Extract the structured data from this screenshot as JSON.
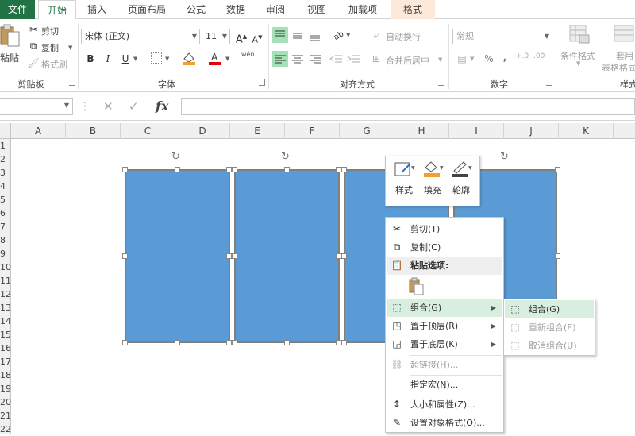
{
  "tabs": [
    {
      "label": "文件"
    },
    {
      "label": "开始"
    },
    {
      "label": "插入"
    },
    {
      "label": "页面布局"
    },
    {
      "label": "公式"
    },
    {
      "label": "数据"
    },
    {
      "label": "审阅"
    },
    {
      "label": "视图"
    },
    {
      "label": "加载项"
    },
    {
      "label": "格式"
    }
  ],
  "clipboard": {
    "paste": "粘贴",
    "cut": "剪切",
    "copy": "复制",
    "format_painter": "格式刷",
    "group": "剪贴板"
  },
  "font": {
    "name": "宋体 (正文)",
    "size": "11",
    "group": "字体",
    "bold": "B",
    "italic": "I",
    "underline": "U",
    "grow": "A",
    "shrink": "A",
    "phonetic": "wén"
  },
  "alignment": {
    "wrap": "自动换行",
    "merge": "合并后居中",
    "group": "对齐方式"
  },
  "number": {
    "format": "常规",
    "group": "数字",
    "percent": "%",
    "comma": ","
  },
  "styles": {
    "conditional": "条件格式",
    "table_line1": "套用",
    "table_line2": "表格格式",
    "group": "样式"
  },
  "formula_bar": {
    "fx": "fx",
    "cancel": "✕",
    "enter": "✓",
    "value": ""
  },
  "columns": [
    "A",
    "B",
    "C",
    "D",
    "E",
    "F",
    "G",
    "H",
    "I",
    "J",
    "K"
  ],
  "rows": [
    "1",
    "2",
    "3",
    "4",
    "5",
    "6",
    "7",
    "8",
    "9",
    "10",
    "11",
    "12",
    "13",
    "14",
    "15",
    "16",
    "17",
    "18",
    "19",
    "20",
    "21",
    "22"
  ],
  "mini_toolbar": [
    {
      "label": "样式"
    },
    {
      "label": "填充"
    },
    {
      "label": "轮廓"
    }
  ],
  "context_menu": {
    "cut": "剪切(T)",
    "copy": "复制(C)",
    "paste_options": "粘贴选项:",
    "group": "组合(G)",
    "bring_front": "置于顶层(R)",
    "send_back": "置于底层(K)",
    "hyperlink": "超链接(H)...",
    "assign_macro": "指定宏(N)...",
    "size_props": "大小和属性(Z)...",
    "format_object": "设置对象格式(O)..."
  },
  "submenu": {
    "group": "组合(G)",
    "regroup": "重新组合(E)",
    "ungroup": "取消组合(U)"
  },
  "colors": {
    "accent": "#217346",
    "shape_fill": "#5b9bd5",
    "font_color": "#e00000",
    "fill_color": "#f0a030",
    "highlight": "#d8efdf"
  }
}
